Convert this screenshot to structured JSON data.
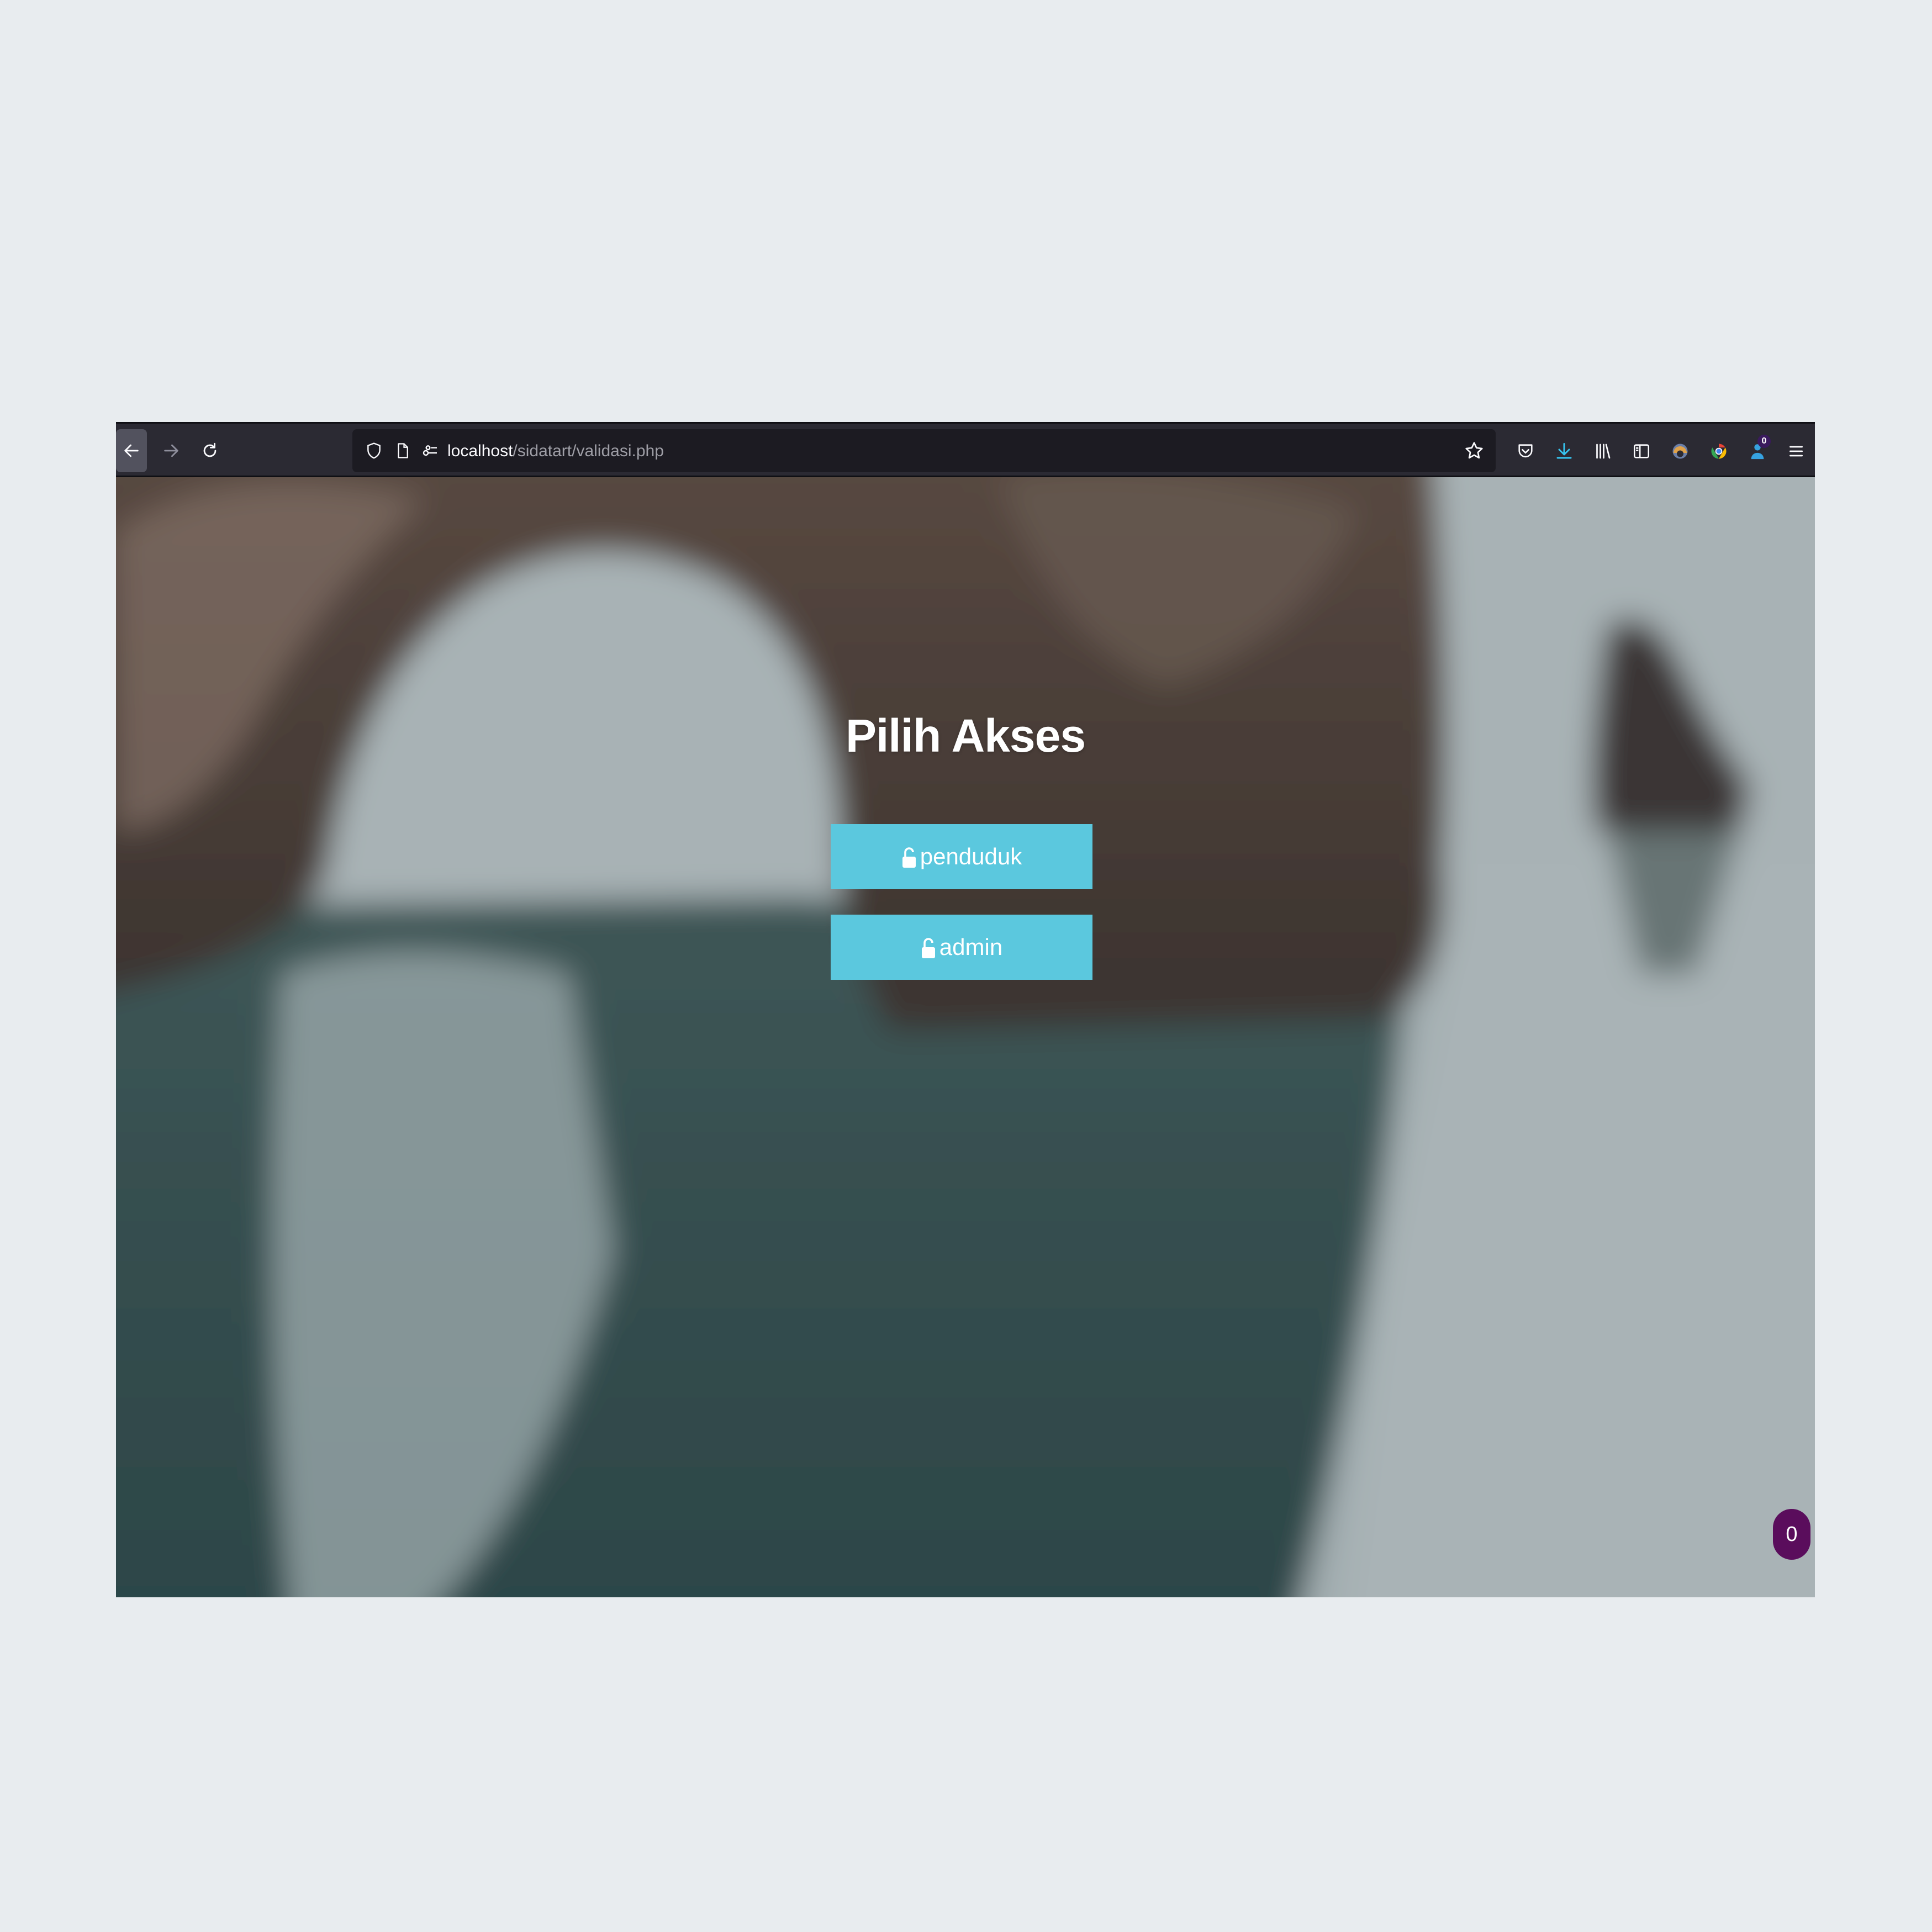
{
  "browser": {
    "url_host": "localhost",
    "url_path": "/sidatart/validasi.php",
    "extension_badge": "0"
  },
  "page": {
    "title": "Pilih Akses",
    "buttons": [
      {
        "label": "penduduk",
        "icon": "unlock-icon"
      },
      {
        "label": "admin",
        "icon": "unlock-icon"
      }
    ],
    "floating_badge": "0"
  },
  "colors": {
    "button_bg": "#5bc8de",
    "toolbar_bg": "#2b2a33",
    "urlbar_bg": "#1c1b22",
    "badge_bg": "#5a0d5c",
    "outer_bg": "#e8ecef"
  }
}
